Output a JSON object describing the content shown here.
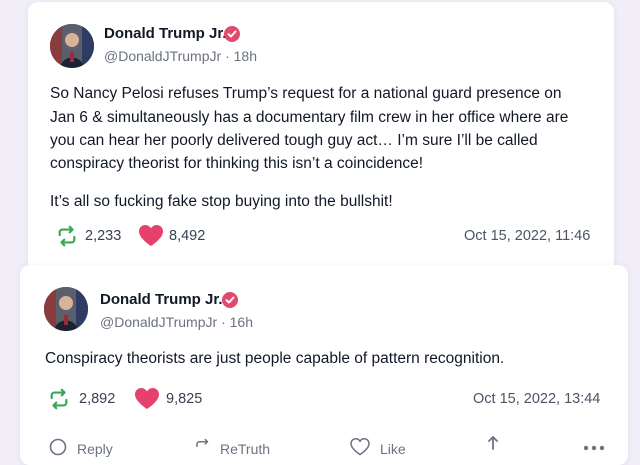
{
  "posts": [
    {
      "name": "Donald Trump Jr.",
      "handle": "@DonaldJTrumpJr",
      "separator": "·",
      "time": "18h",
      "lines": [
        "So Nancy Pelosi refuses Trump’s request for a national guard presence on",
        "Jan 6 & simultaneously has a documentary film crew in her office where are",
        "you can hear her poorly delivered tough guy act… I’m sure I’ll be called",
        "conspiracy theorist for thinking this isn’t a coincidence!",
        "It’s all so fucking fake stop buying into the bullshit!"
      ],
      "retruths": "2,233",
      "likes": "8,492",
      "date": "Oct 15, 2022, 11:46"
    },
    {
      "name": "Donald Trump Jr.",
      "handle": "@DonaldJTrumpJr",
      "separator": "·",
      "time": "16h",
      "lines": [
        "Conspiracy theorists are just people capable of pattern recognition."
      ],
      "retruths": "2,892",
      "likes": "9,825",
      "date": "Oct 15, 2022, 13:44"
    }
  ],
  "actions": {
    "reply": "Reply",
    "retruth": "ReTruth",
    "like": "Like"
  },
  "colors": {
    "retruth_green": "#3aa757",
    "like_pink": "#e6416b",
    "verified_badge": "#e24a6c",
    "background": "#f1eef8"
  },
  "icons": [
    "verified-badge-icon",
    "retruth-icon",
    "heart-icon",
    "reply-icon",
    "share-icon",
    "more-icon"
  ]
}
